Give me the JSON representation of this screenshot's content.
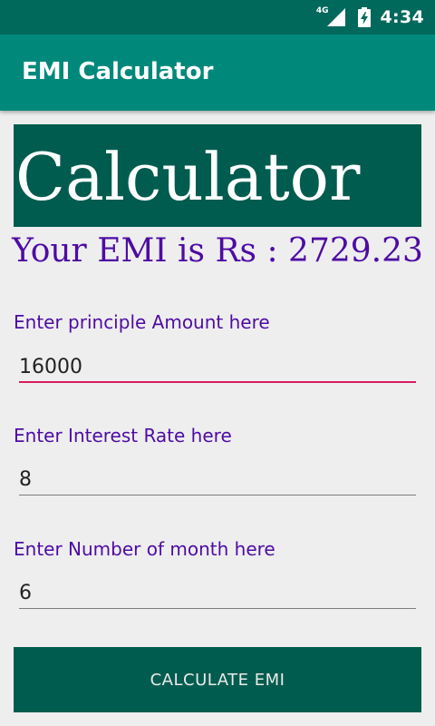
{
  "status_bar": {
    "network": "4G",
    "time": "4:34",
    "icons": [
      "signal-icon",
      "battery-charging-icon"
    ]
  },
  "app_bar": {
    "title": "EMI Calculator"
  },
  "banner": {
    "text": "Calculator"
  },
  "result": {
    "text": "Your EMI is Rs : 2729.23"
  },
  "fields": {
    "principal": {
      "label": "Enter principle Amount here",
      "value": "16000"
    },
    "interest": {
      "label": "Enter Interest Rate here",
      "value": "8"
    },
    "months": {
      "label": "Enter Number of month here",
      "value": "6"
    }
  },
  "button": {
    "label": "CALCULATE EMI"
  },
  "colors": {
    "status_bar": "#00695c",
    "app_bar": "#00897b",
    "banner_bg": "#005c4e",
    "accent_purple": "#4e0ca3",
    "focus_underline": "#d81b60",
    "background": "#eeeeee"
  }
}
